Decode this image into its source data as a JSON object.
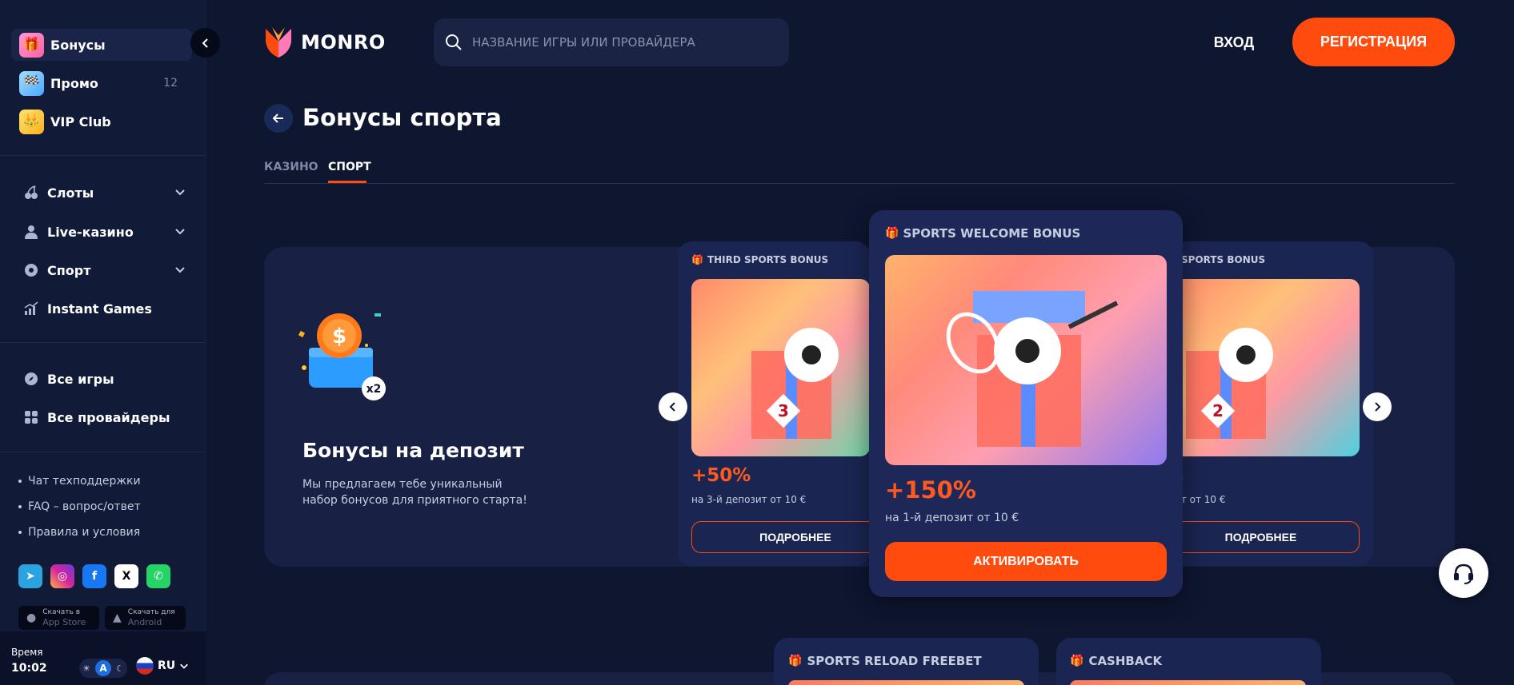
{
  "sidebar": {
    "top_items": [
      {
        "label": "Бонусы",
        "icon": "gift-icon"
      },
      {
        "label": "Промо",
        "count": "12",
        "icon": "promo-icon"
      },
      {
        "label": "VIP Club",
        "icon": "crown-icon"
      }
    ],
    "nav_items": [
      {
        "label": "Слоты",
        "icon": "cherry-icon"
      },
      {
        "label": "Live-казино",
        "icon": "dealer-icon"
      },
      {
        "label": "Спорт",
        "icon": "ball-icon"
      },
      {
        "label": "Instant Games",
        "icon": "chart-icon"
      }
    ],
    "game_items": [
      {
        "label": "Все игры",
        "icon": "compass-icon"
      },
      {
        "label": "Все провайдеры",
        "icon": "grid-icon"
      }
    ],
    "links": [
      "Чат техподдержки",
      "FAQ – вопрос/ответ",
      "Правила и условия"
    ],
    "socials": [
      {
        "name": "telegram",
        "glyph": "➤",
        "color": "#2aa3e0"
      },
      {
        "name": "instagram",
        "glyph": "◎",
        "color": "#d6249f"
      },
      {
        "name": "facebook",
        "glyph": "f",
        "color": "#1877f2"
      },
      {
        "name": "x",
        "glyph": "X",
        "color": "#ffffff"
      },
      {
        "name": "whatsapp",
        "glyph": "✆",
        "color": "#25d366"
      }
    ],
    "stores": [
      {
        "small": "Скачать в",
        "big": "App Store"
      },
      {
        "small": "Скачать для",
        "big": "Android"
      }
    ],
    "footer": {
      "time_label": "Время",
      "time_value": "10:02",
      "theme_auto": "A",
      "language": "RU"
    }
  },
  "header": {
    "logo_text": "MONRO",
    "search_placeholder": "НАЗВАНИЕ ИГРЫ ИЛИ ПРОВАЙДЕРА",
    "login_label": "ВХОД",
    "register_label": "РЕГИСТРАЦИЯ"
  },
  "page": {
    "title": "Бонусы спорта",
    "tabs": [
      "КАЗИНО",
      "СПОРТ"
    ],
    "active_tab": "СПОРТ"
  },
  "promo": {
    "title": "Бонусы на депозит",
    "description": "Мы предлагаем тебе уникальный набор бонусов для приятного старта!",
    "badge": "x2"
  },
  "cards": [
    {
      "label": "THIRD SPORTS BONUS",
      "percent": "+50%",
      "subtitle": "на 3-й депозит от 10 €",
      "button": "ПОДРОБНЕЕ",
      "badge_number": "3"
    },
    {
      "label": "SPORTS WELCOME BONUS",
      "percent": "+150%",
      "subtitle": "на 1-й депозит от 10 €",
      "button": "АКТИВИРОВАТЬ"
    },
    {
      "label": "SPORTS BONUS",
      "percent": "%",
      "subtitle": "ит от 10 €",
      "button": "ПОДРОБНЕЕ",
      "badge_number": "2"
    }
  ],
  "bottom_cards": [
    {
      "label": "SPORTS RELOAD FREEBET"
    },
    {
      "label": "CASHBACK"
    }
  ],
  "colors": {
    "accent": "#ff4b0e",
    "background": "#0e1630",
    "sidebar": "#111a36",
    "card": "#1b2552"
  }
}
